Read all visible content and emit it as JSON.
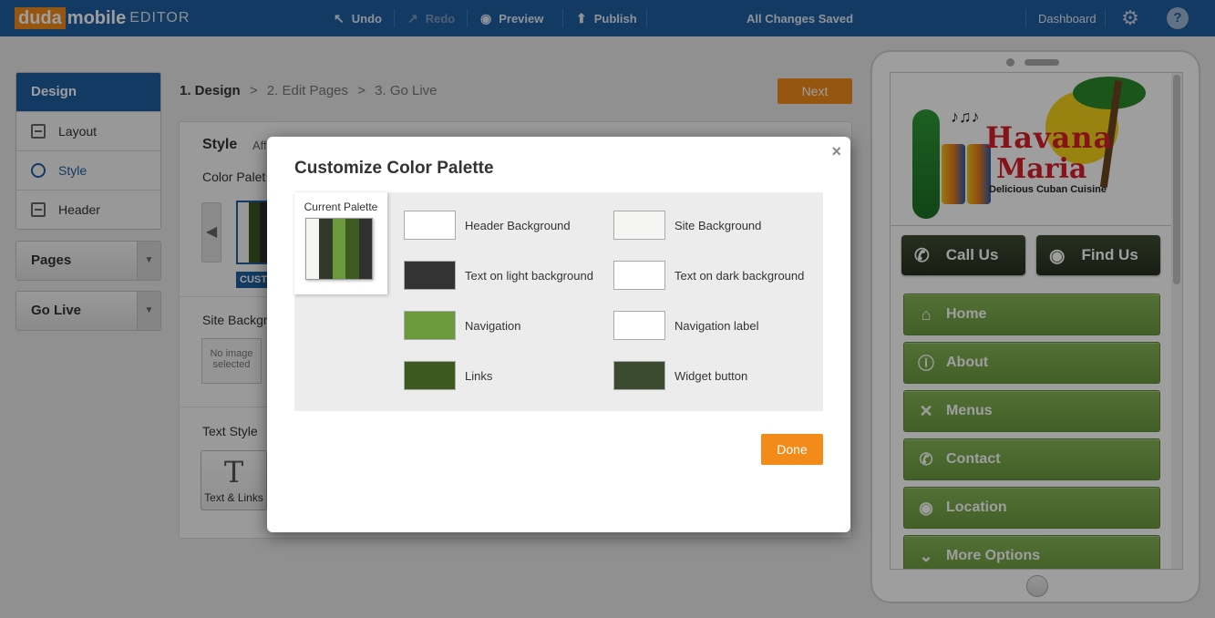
{
  "topbar": {
    "logo_duda": "duda",
    "logo_mobile": "mobile",
    "logo_editor": "EDITOR",
    "undo": "Undo",
    "redo": "Redo",
    "preview": "Preview",
    "publish": "Publish",
    "status": "All Changes Saved",
    "dashboard": "Dashboard",
    "help": "?"
  },
  "sidebar": {
    "design_title": "Design",
    "items": [
      {
        "label": "Layout",
        "icon": "layout-icon"
      },
      {
        "label": "Style",
        "icon": "palette-icon"
      },
      {
        "label": "Header",
        "icon": "header-icon"
      }
    ],
    "pages": "Pages",
    "golive": "Go Live"
  },
  "steps": {
    "step1": "1. Design",
    "sep1": ">",
    "step2": "2. Edit Pages",
    "sep2": ">",
    "step3": "3. Go Live",
    "next": "Next"
  },
  "main": {
    "style_title": "Style",
    "style_sub": "Aff",
    "color_palette_label": "Color Palet",
    "custom_tag": "CUST",
    "site_bg_label": "Site Backgr",
    "no_image": "No image selected",
    "text_style_label": "Text Style",
    "text_links": "Text & Links"
  },
  "modal": {
    "title": "Customize Color Palette",
    "close": "×",
    "current_palette_label": "Current Palette",
    "current_palette_colors": [
      "#f5f5f3",
      "#33392a",
      "#6a9a3c",
      "#3d5a22",
      "#303030"
    ],
    "colors": [
      {
        "label": "Header Background",
        "color": "#ffffff"
      },
      {
        "label": "Site Background",
        "color": "#f5f5f3"
      },
      {
        "label": "Text on light background",
        "color": "#333333"
      },
      {
        "label": "Text on dark background",
        "color": "#ffffff"
      },
      {
        "label": "Navigation",
        "color": "#6a9a3c"
      },
      {
        "label": "Navigation label",
        "color": "#ffffff"
      },
      {
        "label": "Links",
        "color": "#3d5a1e"
      },
      {
        "label": "Widget button",
        "color": "#3a4a2c"
      }
    ],
    "done": "Done"
  },
  "preview": {
    "brand_line1": "Havana",
    "brand_line2": "Maria",
    "brand_tagline": "Delicious Cuban Cuisine",
    "notes": "♪♫♪",
    "call_us": "Call Us",
    "find_us": "Find Us",
    "nav_items": [
      {
        "label": "Home",
        "icon": "home-icon"
      },
      {
        "label": "About",
        "icon": "info-icon"
      },
      {
        "label": "Menus",
        "icon": "fork-knife-icon"
      },
      {
        "label": "Contact",
        "icon": "phone-icon"
      },
      {
        "label": "Location",
        "icon": "location-pin-icon"
      },
      {
        "label": "More Options",
        "icon": "chevron-down-icon"
      }
    ]
  }
}
